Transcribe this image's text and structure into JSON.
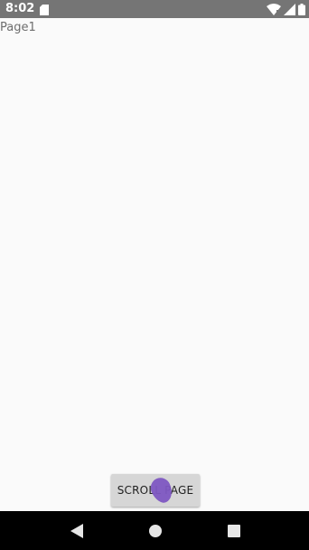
{
  "status_bar": {
    "time": "8:02",
    "icons": [
      "sd-card-icon",
      "wifi-icon",
      "signal-icon",
      "battery-icon"
    ]
  },
  "page": {
    "label": "Page1"
  },
  "button": {
    "label": "SCROLL PAGE"
  },
  "nav_bar": {
    "icons": [
      "back-icon",
      "home-icon",
      "recents-icon"
    ]
  },
  "colors": {
    "status_bar": "#757575",
    "background": "#fafafa",
    "button": "#d6d6d6",
    "touch_indicator": "#7e57c2",
    "nav_bar": "#000000"
  }
}
